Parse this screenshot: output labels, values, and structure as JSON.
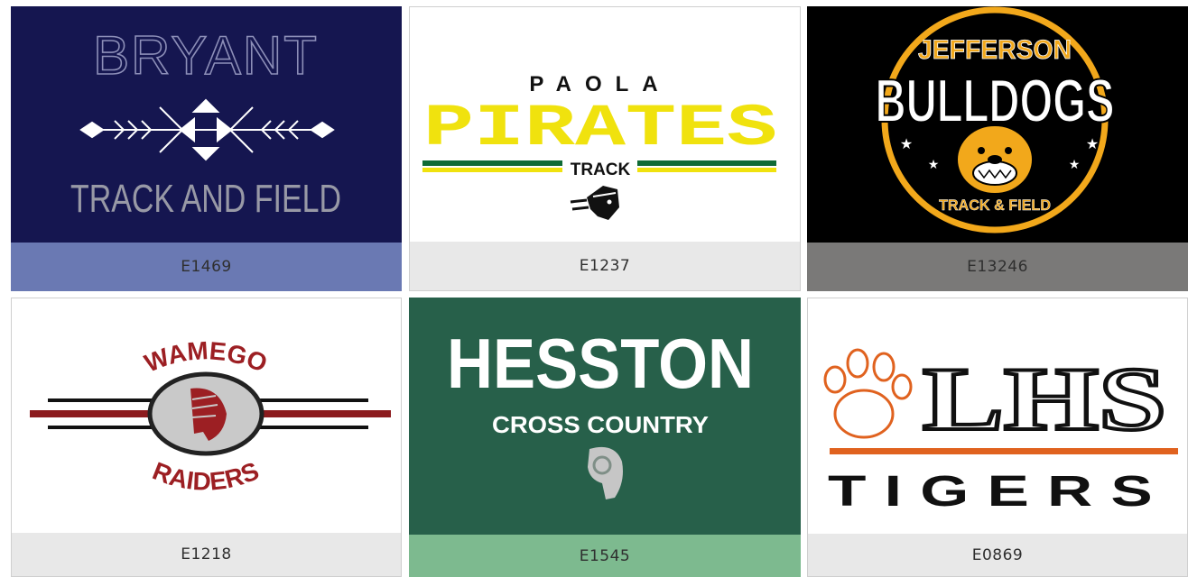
{
  "cards": [
    {
      "code": "E1469",
      "caption_bg": "#6a79b3",
      "art_bg": "#151650",
      "lines": [
        "BRYANT",
        "TRACK AND FIELD"
      ]
    },
    {
      "code": "E1237",
      "caption_bg": "#e8e8e8",
      "art_bg": "#ffffff",
      "lines": [
        "PAOLA",
        "PIRATES",
        "TRACK"
      ]
    },
    {
      "code": "E13246",
      "caption_bg": "#7a7978",
      "art_bg": "#000000",
      "lines": [
        "JEFFERSON",
        "BULLDOGS",
        "TRACK & FIELD"
      ]
    },
    {
      "code": "E1218",
      "caption_bg": "#e8e8e8",
      "art_bg": "#ffffff",
      "lines": [
        "WAMEGO",
        "RAIDERS"
      ]
    },
    {
      "code": "E1545",
      "caption_bg": "#7dba8f",
      "art_bg": "#27604a",
      "lines": [
        "HESSTON",
        "CROSS COUNTRY"
      ]
    },
    {
      "code": "E0869",
      "caption_bg": "#e8e8e8",
      "art_bg": "#ffffff",
      "lines": [
        "LHS",
        "TIGERS"
      ]
    }
  ]
}
